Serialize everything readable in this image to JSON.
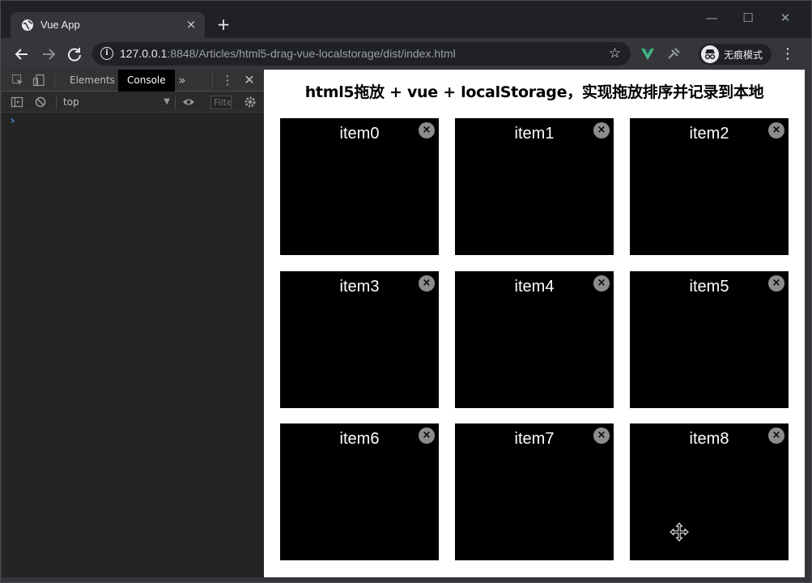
{
  "browser": {
    "tab_title": "Vue App",
    "tab_close": "×",
    "new_tab": "+",
    "window_controls": {
      "minimize": "—",
      "maximize": "☐",
      "close": "✕"
    },
    "url_host": "127.0.0.1",
    "url_rest": ":8848/Articles/html5-drag-vue-localstorage/dist/index.html",
    "profile_label": "无痕模式",
    "icons": [
      "back-icon",
      "forward-icon",
      "reload-icon",
      "info-icon",
      "star-icon",
      "vue-devtools-icon",
      "extension-icon",
      "incognito-icon",
      "menu-icon"
    ]
  },
  "devtools": {
    "tabs": [
      {
        "label": "Elements",
        "active": false
      },
      {
        "label": "Console",
        "active": true
      }
    ],
    "more_tabs": "»",
    "context": "top",
    "filter_placeholder": "Filter",
    "prompt": "›"
  },
  "page": {
    "title": "html5拖放 + vue + localStorage，实现拖放排序并记录到本地",
    "items": [
      "item0",
      "item1",
      "item2",
      "item3",
      "item4",
      "item5",
      "item6",
      "item7",
      "item8"
    ],
    "close_glyph": "×"
  },
  "colors": {
    "chrome_bg": "#202124",
    "toolbar_bg": "#35363a",
    "devtools_bg": "#242424",
    "card_bg": "#000000",
    "close_btn_bg": "#8c8c8c",
    "console_prompt": "#4d9cf0"
  }
}
